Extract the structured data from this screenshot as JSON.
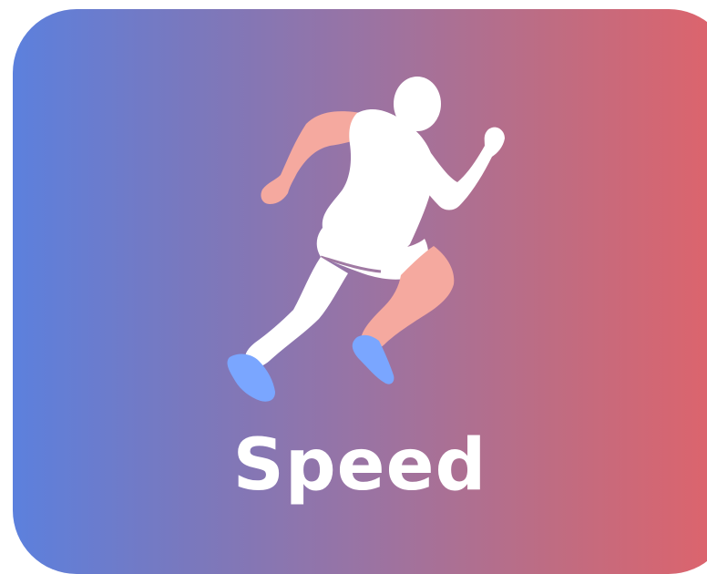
{
  "card": {
    "label": "Speed",
    "icon": "running-person-icon",
    "gradient_colors": [
      "#5c80dd",
      "#e0636a"
    ],
    "figure_colors": {
      "body": "#ffffff",
      "skin": "#f5a99f",
      "shoes": "#7aa6ff"
    }
  }
}
